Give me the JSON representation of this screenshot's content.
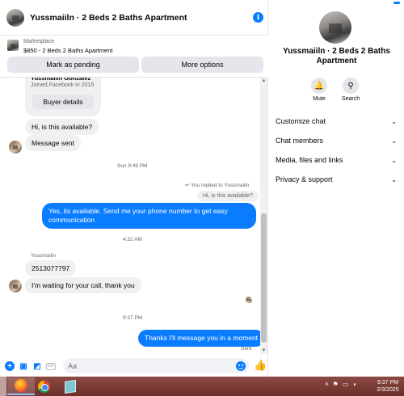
{
  "header": {
    "title": "Yussmaiiln · 2 Beds 2 Baths Apartment"
  },
  "marketplace": {
    "label": "Marketplace",
    "item": "$850 - 2 Beds 2 Baths Apartment",
    "mark_pending": "Mark as pending",
    "more_options": "More options"
  },
  "profile_card": {
    "name": "Yussmaiiln Gonzalez",
    "joined": "Joined Facebook in 2015",
    "buyer_details": "Buyer details"
  },
  "messages": {
    "m1": "Hi, is this available?",
    "m2": "Message sent",
    "ts1": "Sun 9:49 PM",
    "reply_note": "You replied to Yussmaiiln",
    "quoted": "Hi, is this available?",
    "m3": "Yes, its available. Send me your phone number to get easy communication",
    "ts2": "4:32 AM",
    "sender": "Yussmaiiln",
    "m4": "2513077797",
    "m5": "I'm waiting for your call, thank you",
    "ts3": "9:37 PM",
    "m6": "Thanks I'll message you in a moment",
    "sent": "Sent"
  },
  "composer": {
    "placeholder": "Aa"
  },
  "panel": {
    "title": "Yussmaiiln · 2 Beds 2 Baths Apartment",
    "mute": "Mute",
    "search": "Search",
    "rows": [
      "Customize chat",
      "Chat members",
      "Media, files and links",
      "Privacy & support"
    ]
  },
  "taskbar": {
    "time": "9:37 PM",
    "date": "2/3/2025"
  },
  "colors": {
    "accent": "#0a7cff",
    "bubble_in": "#f0f0f0",
    "taskbar": "#7a3a35"
  }
}
